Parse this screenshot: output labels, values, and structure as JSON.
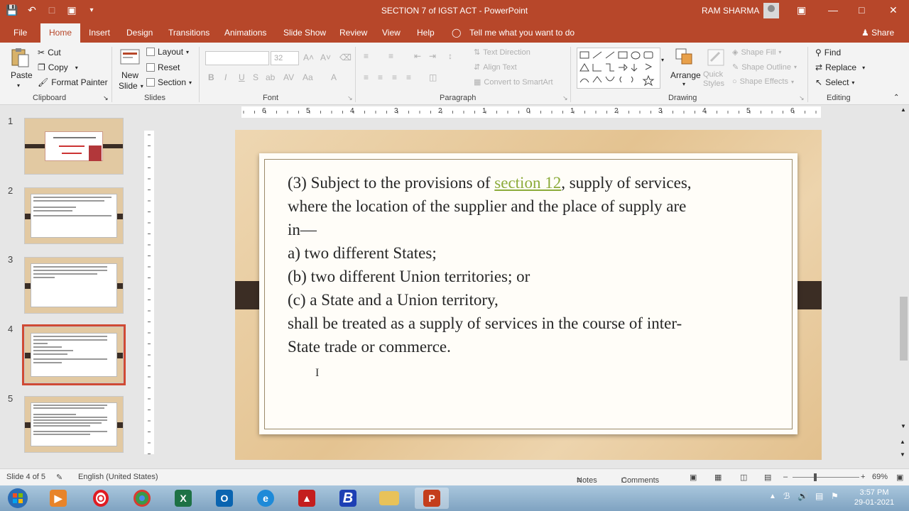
{
  "window": {
    "title": "SECTION  7 of IGST ACT  -  PowerPoint",
    "user": "RAM  SHARMA"
  },
  "tabs": [
    "File",
    "Home",
    "Insert",
    "Design",
    "Transitions",
    "Animations",
    "Slide Show",
    "Review",
    "View",
    "Help"
  ],
  "tell_me": "Tell me what you want to do",
  "share": "Share",
  "ribbon": {
    "clipboard": {
      "paste": "Paste",
      "cut": "Cut",
      "copy": "Copy",
      "format_painter": "Format Painter",
      "label": "Clipboard"
    },
    "slides": {
      "new_slide": "New",
      "new_slide2": "Slide",
      "layout": "Layout",
      "reset": "Reset",
      "section": "Section",
      "label": "Slides"
    },
    "font": {
      "size": "32",
      "label": "Font"
    },
    "paragraph": {
      "text_direction": "Text Direction",
      "align_text": "Align Text",
      "smartart": "Convert to SmartArt",
      "label": "Paragraph"
    },
    "drawing": {
      "arrange": "Arrange",
      "quick_styles": "Quick Styles",
      "shape_fill": "Shape Fill",
      "shape_outline": "Shape Outline",
      "shape_effects": "Shape Effects",
      "label": "Drawing"
    },
    "editing": {
      "find": "Find",
      "replace": "Replace",
      "select": "Select",
      "label": "Editing"
    }
  },
  "thumb_numbers": [
    "1",
    "2",
    "3",
    "4",
    "5"
  ],
  "slide": {
    "line1_pre": "(3) Subject to the provisions of ",
    "line1_link": "section 12",
    "line1_post": ", supply of services,",
    "line2": "where the location of the supplier and the place of supply are",
    "line3": "in—",
    "line4": "a) two different States;",
    "line5": "(b) two different Union territories; or",
    "line6": "(c) a State and a Union territory,",
    "line7": "shall be treated as a supply of services in the course of inter-",
    "line8": "State trade or commerce."
  },
  "ruler_ticks": [
    "6",
    "5",
    "4",
    "3",
    "2",
    "1",
    "0",
    "1",
    "2",
    "3",
    "4",
    "5",
    "6"
  ],
  "status": {
    "slide_of": "Slide 4 of 5",
    "language": "English (United States)",
    "notes": "Notes",
    "comments": "Comments",
    "zoom": "69%"
  },
  "taskbar": {
    "time": "3:57 PM",
    "date": "29-01-2021"
  }
}
